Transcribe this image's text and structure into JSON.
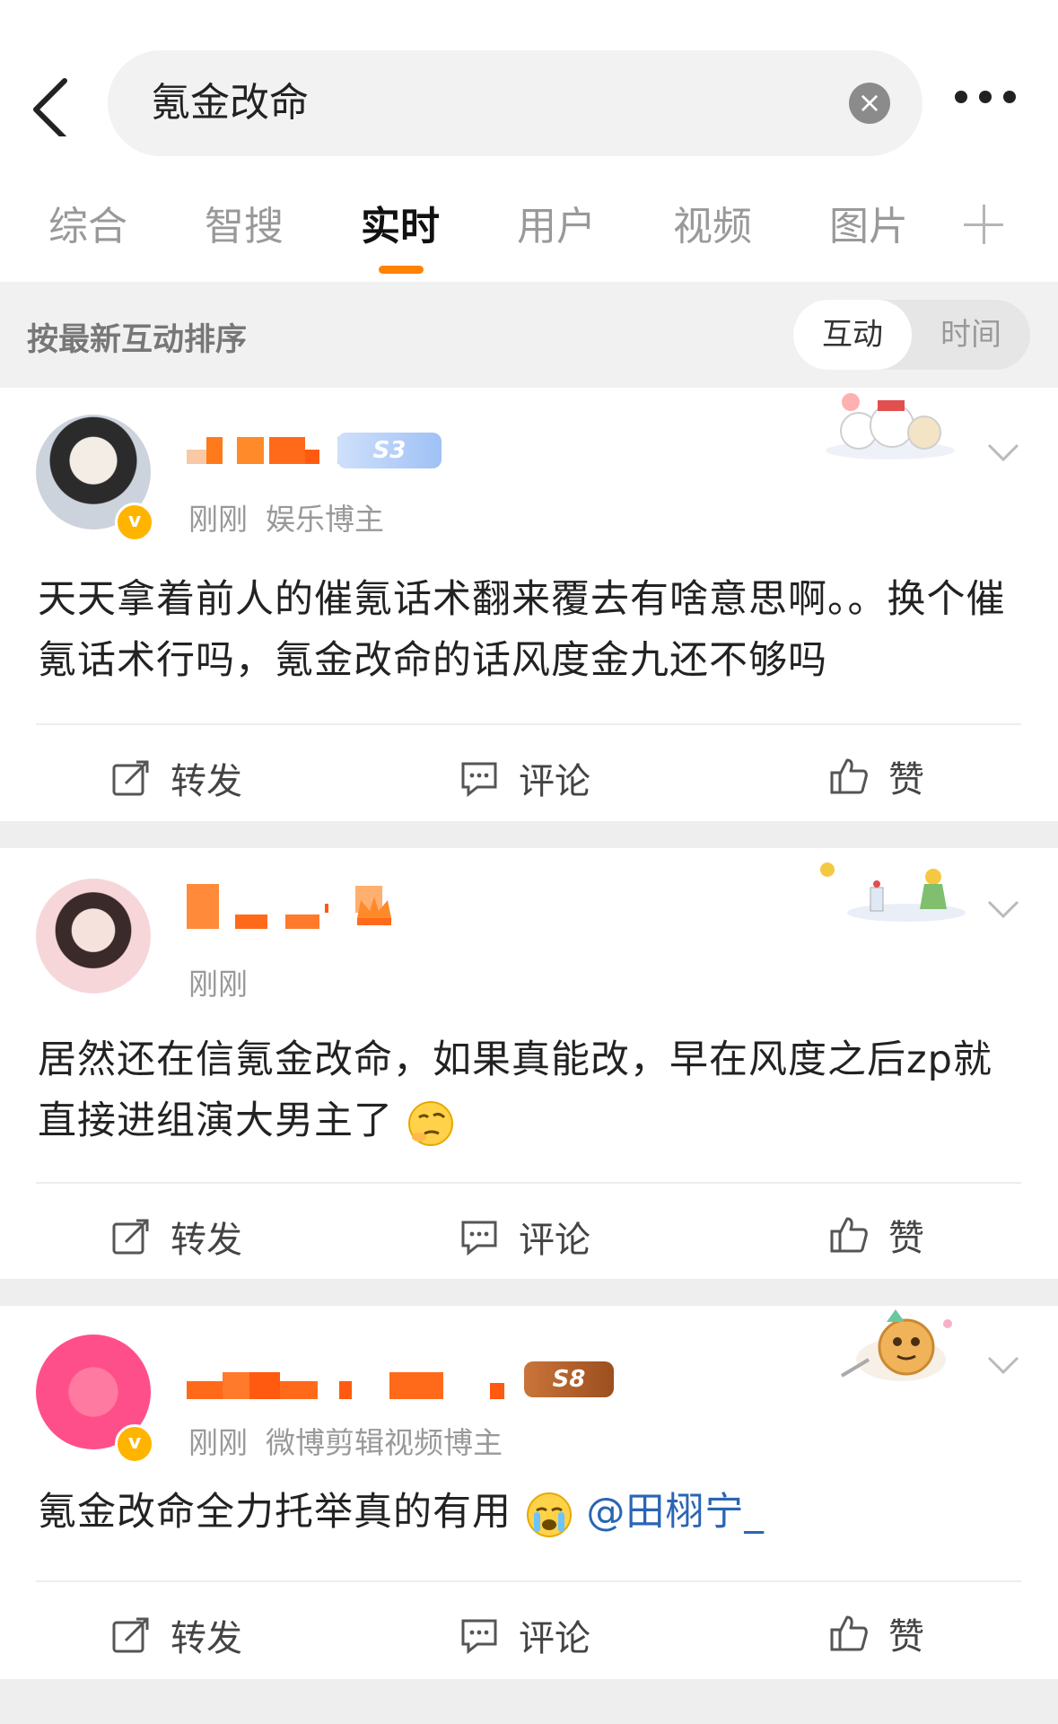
{
  "search": {
    "query": "氪金改命"
  },
  "tabs": [
    {
      "label": "综合"
    },
    {
      "label": "智搜"
    },
    {
      "label": "实时"
    },
    {
      "label": "用户"
    },
    {
      "label": "视频"
    },
    {
      "label": "图片"
    }
  ],
  "active_tab": "实时",
  "sort": {
    "label": "按最新互动排序",
    "option_active": "互动",
    "option_inactive": "时间"
  },
  "posts": [
    {
      "time": "刚刚",
      "role": "娱乐博主",
      "level": "S3",
      "content": "天天拿着前人的催氪话术翻来覆去有啥意思啊。。换个催氪话术行吗，氪金改命的话风度金九还不够吗",
      "actions": {
        "repost": "转发",
        "comment": "评论",
        "like": "赞"
      }
    },
    {
      "time": "刚刚",
      "content": "居然还在信氪金改命，如果真能改，早在风度之后zp就直接进组演大男主了",
      "actions": {
        "repost": "转发",
        "comment": "评论",
        "like": "赞"
      }
    },
    {
      "time": "刚刚",
      "role": "微博剪辑视频博主",
      "level": "S8",
      "content": "氪金改命全力托举真的有用",
      "mention": "@田栩宁_",
      "actions": {
        "repost": "转发",
        "comment": "评论",
        "like": "赞"
      }
    }
  ],
  "colors": {
    "accent": "#ff8200",
    "link": "#2a65b4",
    "badge": "#ffb400"
  }
}
